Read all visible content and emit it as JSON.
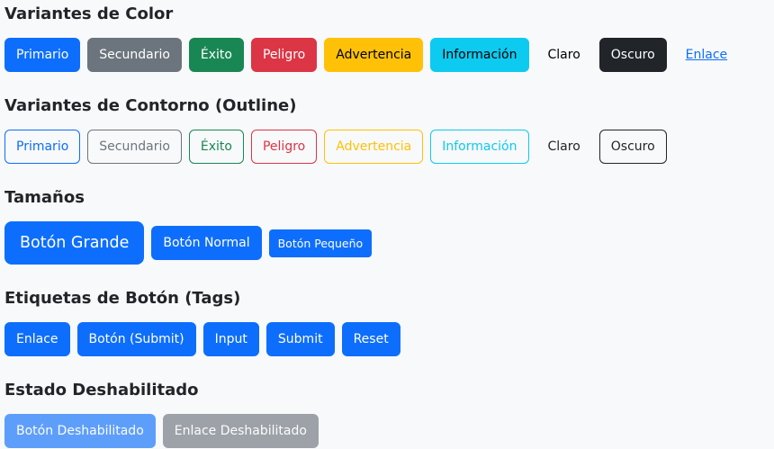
{
  "colors": {
    "primary": "#0d6efd",
    "secondary": "#6c757d",
    "success": "#198754",
    "danger": "#dc3545",
    "warning": "#ffc107",
    "info": "#0dcaf0",
    "light": "#f8f9fa",
    "dark": "#212529"
  },
  "sections": {
    "color_variants": {
      "title": "Variantes de Color",
      "buttons": [
        "Primario",
        "Secundario",
        "Éxito",
        "Peligro",
        "Advertencia",
        "Información",
        "Claro",
        "Oscuro",
        "Enlace"
      ]
    },
    "outline_variants": {
      "title": "Variantes de Contorno (Outline)",
      "buttons": [
        "Primario",
        "Secundario",
        "Éxito",
        "Peligro",
        "Advertencia",
        "Información",
        "Claro",
        "Oscuro"
      ]
    },
    "sizes": {
      "title": "Tamaños",
      "buttons": [
        "Botón Grande",
        "Botón Normal",
        "Botón Pequeño"
      ]
    },
    "tags": {
      "title": "Etiquetas de Botón (Tags)",
      "buttons": [
        "Enlace",
        "Botón (Submit)",
        "Input",
        "Submit",
        "Reset"
      ]
    },
    "disabled": {
      "title": "Estado Deshabilitado",
      "buttons": [
        "Botón Deshabilitado",
        "Enlace Deshabilitado"
      ]
    }
  }
}
